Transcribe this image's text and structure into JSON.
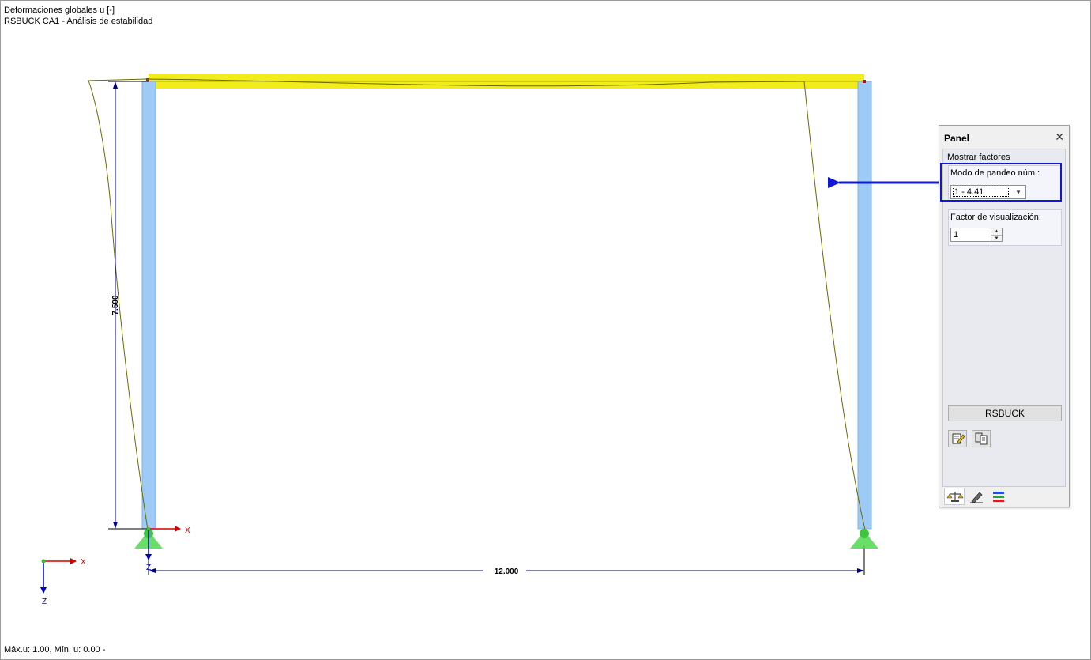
{
  "view": {
    "title_line1": "Deformaciones globales u [-]",
    "title_line2": "RSBUCK CA1 - Análisis de estabilidad",
    "status": "Máx.u: 1.00, Mín. u: 0.00 -"
  },
  "model": {
    "height_dim": "7.500",
    "span_dim": "12.000",
    "local_axis_x": "X",
    "local_axis_z": "Z",
    "global_axis_x": "X",
    "global_axis_z": "Z",
    "colors": {
      "column": "#9ecbf5",
      "beam": "#f2ec1a",
      "deformed": "#6b6b00",
      "dimension": "#000080",
      "support": "#4fd94f",
      "axis_x": "#d40000",
      "axis_z": "#0000c0",
      "annotation_arrow": "#1018d8"
    }
  },
  "panel": {
    "title": "Panel",
    "section": "Mostrar factores",
    "mode_label": "Modo de pandeo núm.:",
    "mode_value": "1 - 4.41",
    "factor_label": "Factor de visualización:",
    "factor_value": "1",
    "rsbuck_button": "RSBUCK",
    "icons": [
      "edit-icon",
      "copy-icon"
    ],
    "tabs": [
      "scale-icon",
      "pencil-icon",
      "color-bars-icon"
    ]
  }
}
